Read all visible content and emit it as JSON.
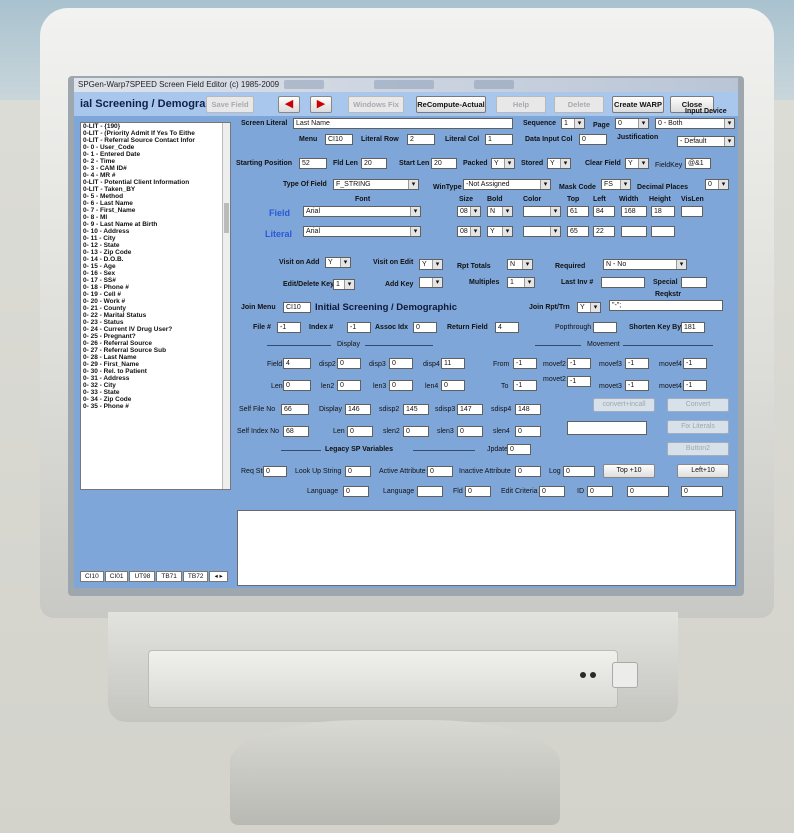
{
  "window_title": "SPGen-Warp7SPEED Screen Field Editor (c) 1985-2009",
  "toolbar": {
    "app_title": "ial Screening / Demograp",
    "save_field": "Save Field",
    "back_arrow": "◀",
    "forward_arrow": "▶",
    "windows_fix": "Windows Fix",
    "recompute": "ReCompute-Actual",
    "help": "Help",
    "delete": "Delete",
    "create_warp": "Create WARP",
    "close": "Close"
  },
  "field_list": [
    "0-LIT - {190}",
    "0-LIT - (Priority Admit If Yes To Eithe",
    "0-LIT - Referral Source Contact Infor",
    "0- 0 - User_Code",
    "0- 1 - Entered Date",
    "0- 2 - Time",
    "0- 3 - CAM ID#",
    "0- 4 - MR #",
    "0-LIT - Potential Client Information",
    "0-LIT - Taken_BY",
    "0- 5 - Method",
    "0- 6 - Last Name",
    "0- 7 - First_Name",
    "0- 8 - MI",
    "0- 9 - Last Name at Birth",
    "0- 10 - Address",
    "0- 11 - City",
    "0- 12 - State",
    "0- 13 - Zip Code",
    "0- 14 - D.O.B.",
    "0- 15 - Age",
    "0- 16 - Sex",
    "0- 17 - SS#",
    "0- 18 - Phone #",
    "0- 19 - Cell #",
    "0- 20 - Work #",
    "0- 21 - County",
    "0- 22 - Marital Status",
    "0- 23 - Status",
    "0- 24 - Current IV Drug User?",
    "0- 25 - Pregnant?",
    "0- 26 - Referral Source",
    "0- 27 - Referral Source Sub",
    "0- 28 - Last Name",
    "0- 29 - First_Name",
    "0- 30 - Rel. to Patient",
    "0- 31 - Address",
    "0- 32 - City",
    "0- 33 - State",
    "0- 34 - Zip Code",
    "0- 35 - Phone #"
  ],
  "tabs": [
    "CI10",
    "CI01",
    "UT98",
    "TB71",
    "TB72",
    "◂ ▸"
  ],
  "form": {
    "screen_literal_label": "Screen Literal",
    "screen_literal_value": "Last Name",
    "sequence_label": "Sequence",
    "sequence_value": "1",
    "page_label": "Page",
    "page_value": "0",
    "input_device_label": "Input Device",
    "input_device_value": "0 - Both",
    "menu_label": "Menu",
    "menu_value": "CI10",
    "literal_row_label": "Literal Row",
    "literal_row_value": "2",
    "literal_col_label": "Literal Col",
    "literal_col_value": "1",
    "data_input_col_label": "Data Input Col",
    "data_input_col_value": "0",
    "justification_label": "Justification",
    "justification_value": "- Default",
    "starting_position_label": "Starting Position",
    "starting_position_value": "52",
    "fld_len_label": "Fld Len",
    "fld_len_value": "20",
    "start_len_label": "Start Len",
    "start_len_value": "20",
    "packed_label": "Packed",
    "packed_value": "Y",
    "stored_label": "Stored",
    "stored_value": "Y",
    "clear_field_label": "Clear Field",
    "clear_field_value": "Y",
    "fieldkey_label": "FieldKey",
    "fieldkey_value": "@&1",
    "type_of_field_label": "Type Of Field",
    "type_of_field_value": "F_STRING",
    "wintype_label": "WinType",
    "wintype_value": "-Not Assigned",
    "mask_code_label": "Mask Code",
    "mask_code_value": "FS",
    "decimal_places_label": "Decimal Places",
    "decimal_places_value": "0",
    "font_header": "Font",
    "size_header": "Size",
    "bold_header": "Bold",
    "color_header": "Color",
    "top_header": "Top",
    "left_header": "Left",
    "width_header": "Width",
    "height_header": "Height",
    "vislen_header": "VisLen",
    "field_row_label": "Field",
    "field_font": "Arial",
    "field_size": "08",
    "field_bold": "N",
    "field_color": "",
    "field_top": "61",
    "field_left": "84",
    "field_width": "168",
    "field_height": "18",
    "field_vislen": "",
    "literal_row_label2": "Literal",
    "literal_font": "Arial",
    "literal_size": "08",
    "literal_bold": "Y",
    "literal_color": "",
    "literal_top": "65",
    "literal_left": "22",
    "literal_width": "",
    "literal_height": "",
    "visit_on_add_label": "Visit on Add",
    "visit_on_add_value": "Y",
    "visit_on_edit_label": "Visit on Edit",
    "visit_on_edit_value": "Y",
    "rpt_totals_label": "Rpt Totals",
    "rpt_totals_value": "N",
    "required_label": "Required",
    "required_value": "N - No",
    "edit_delete_key_label": "Edit/Delete Key",
    "edit_delete_key_value": "1",
    "add_key_label": "Add Key",
    "add_key_value": "",
    "multiples_label": "Multiples",
    "multiples_value": "1",
    "last_inv_label": "Last Inv #",
    "last_inv_value": "",
    "special_label": "Special",
    "special_value": "",
    "reqkstr_label": "Reqkstr",
    "reqkstr_value": "\"-\";",
    "join_menu_label": "Join Menu",
    "join_menu_value": "CI10",
    "screen_heading": "Initial Screening / Demographic",
    "join_rpt_label": "Join Rpt/Trn",
    "join_rpt_value": "Y",
    "file_label": "File #",
    "file_value": "-1",
    "index_label": "Index #",
    "index_value": "-1",
    "assoc_idx_label": "Assoc Idx",
    "assoc_idx_value": "0",
    "return_field_label": "Return Field",
    "return_field_value": "4",
    "popthrough_label": "Popthrough",
    "popthrough_value": "",
    "shorten_key_label": "Shorten Key By",
    "shorten_key_value": "181",
    "display_header": "Display",
    "movement_header": "Movement",
    "field2_label": "Field",
    "field2_value": "4",
    "disp2_label": "disp2",
    "disp2_value": "0",
    "disp3_label": "disp3",
    "disp3_value": "0",
    "disp4_label": "disp4",
    "disp4_value": "11",
    "from_label": "From",
    "from_value": "-1",
    "movef2_label": "movef2",
    "movef2_value": "-1",
    "movef3_label": "movef3",
    "movef3_value": "-1",
    "movef4_label": "movef4",
    "movef4_value": "-1",
    "len_label": "Len",
    "len_value": "0",
    "len2_label": "len2",
    "len2_value": "0",
    "len3_label": "len3",
    "len3_value": "0",
    "len4_label": "len4",
    "len4_value": "0",
    "to_label": "To",
    "to_value": "-1",
    "movet2_label": "movet2",
    "movet2_value": "-1",
    "movet3_label": "movet3",
    "movet3_value": "-1",
    "movet4_label": "movet4",
    "movet4_value": "-1",
    "convert_incall": "convert+incall",
    "convert": "Convert",
    "self_file_label": "Self File No",
    "self_file_value": "66",
    "display_label": "Display",
    "display_value": "146",
    "sdisp2_label": "sdisp2",
    "sdisp2_value": "145",
    "sdisp3_label": "sdisp3",
    "sdisp3_value": "147",
    "sdisp4_label": "sdisp4",
    "sdisp4_value": "148",
    "fix_literals": "Fix Literals",
    "self_index_label": "Self Index No",
    "self_index_value": "68",
    "len5_label": "Len",
    "len5_value": "0",
    "slen2_label": "slen2",
    "slen2_value": "0",
    "slen3_label": "slen3",
    "slen3_value": "0",
    "slen4_label": "slen4",
    "slen4_value": "0",
    "legacy_header": "Legacy SP Variables",
    "jupdate_label": "Jpdate",
    "jupdate_value": "0",
    "button2": "Button2",
    "req_str_label": "Req Str",
    "req_str_value": "0",
    "lookup_label": "Look Up String",
    "lookup_value": "0",
    "active_attr_label": "Active Attribute",
    "active_attr_value": "0",
    "inactive_attr_label": "Inactive Attribute",
    "inactive_attr_value": "0",
    "log_label": "Log",
    "log_value": "0",
    "top10": "Top +10",
    "left10": "Left+10",
    "language_label": "Language",
    "language_value": "0",
    "language2_label": "Language",
    "language2_value": "",
    "fld_label": "Fld",
    "fld_value": "0",
    "edit_criteria_label": "Edit Criteria",
    "edit_criteria_value": "0",
    "id_label": "ID",
    "id_value": "0",
    "extra1_value": "0",
    "extra2_value": "0"
  }
}
